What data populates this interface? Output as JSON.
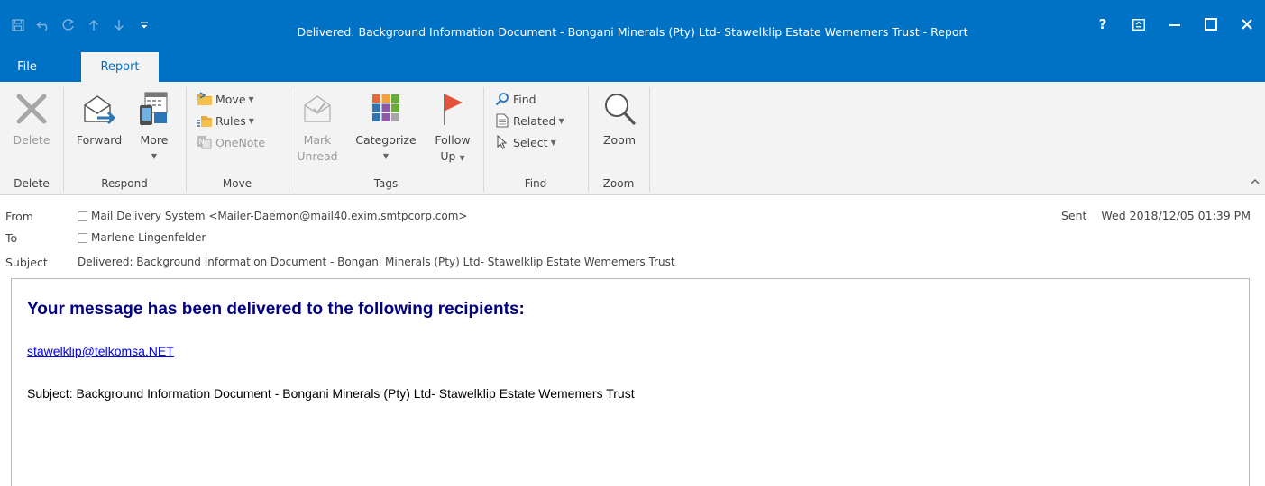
{
  "window": {
    "title": "Delivered: Background Information Document - Bongani Minerals (Pty) Ltd- Stawelklip Estate Wememers Trust - Report",
    "help_label": "?",
    "accent_color": "#0072c6"
  },
  "tabs": [
    {
      "label": "File"
    },
    {
      "label": "Report",
      "selected": true
    }
  ],
  "ribbon": {
    "delete_group": {
      "delete_label": "Delete",
      "group_label": "Delete"
    },
    "respond_group": {
      "forward_label": "Forward",
      "more_label": "More",
      "group_label": "Respond"
    },
    "move_group": {
      "move_label": "Move",
      "rules_label": "Rules",
      "onenote_label": "OneNote",
      "group_label": "Move"
    },
    "tags_group": {
      "mark_label_1": "Mark",
      "mark_label_2": "Unread",
      "categorize_label": "Categorize",
      "follow_label_1": "Follow",
      "follow_label_2": "Up",
      "group_label": "Tags"
    },
    "find_group": {
      "find_label": "Find",
      "related_label": "Related",
      "select_label": "Select",
      "group_label": "Find"
    },
    "zoom_group": {
      "zoom_label": "Zoom",
      "group_label": "Zoom"
    }
  },
  "message": {
    "from_label": "From",
    "from_value": "Mail Delivery System <Mailer-Daemon@mail40.exim.smtpcorp.com>",
    "to_label": "To",
    "to_value": "Marlene Lingenfelder",
    "subject_label": "Subject",
    "subject_value": "Delivered: Background Information Document - Bongani Minerals (Pty) Ltd- Stawelklip Estate Wememers Trust",
    "sent_label": "Sent",
    "sent_value": "Wed 2018/12/05 01:39 PM"
  },
  "body": {
    "heading": "Your message has been delivered to the following recipients:",
    "recipient": "stawelklip@telkomsa.NET",
    "subject_line": "Subject: Background Information Document - Bongani Minerals (Pty) Ltd- Stawelklip Estate Wememers Trust"
  }
}
